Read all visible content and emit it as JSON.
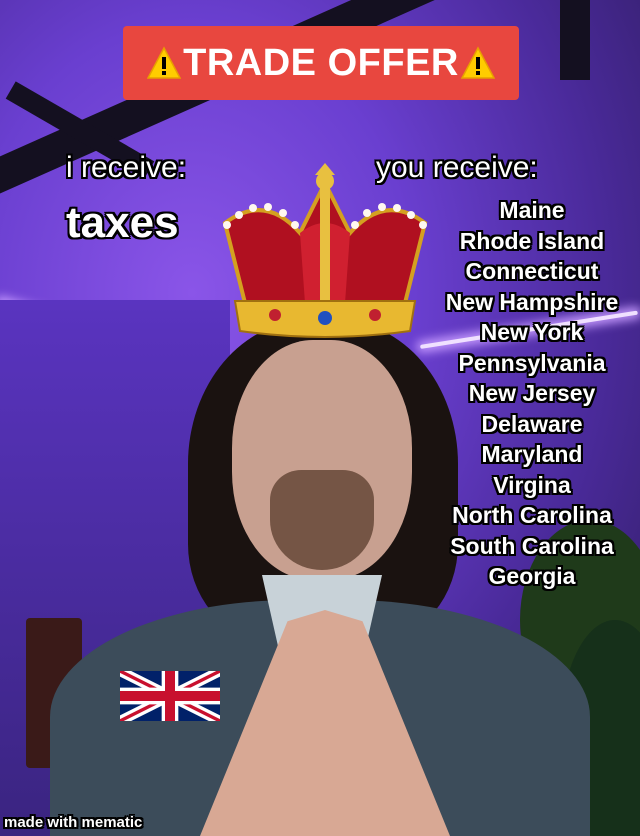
{
  "banner": {
    "title": "TRADE OFFER",
    "icon": "warning-icon"
  },
  "left": {
    "heading": "i receive:",
    "item": "taxes"
  },
  "right": {
    "heading": "you receive:",
    "items": [
      "Maine",
      "Rhode Island",
      "Connecticut",
      "New Hampshire",
      "New York",
      "Pennsylvania",
      "New Jersey",
      "Delaware",
      "Maryland",
      "Virgina",
      "North Carolina",
      "South Carolina",
      "Georgia"
    ]
  },
  "overlays": {
    "crown": "crown-emoji",
    "flag": "uk-flag-emoji"
  },
  "watermark": "made with mematic",
  "colors": {
    "banner": "#e8473f",
    "background": "#6a3fd0"
  }
}
